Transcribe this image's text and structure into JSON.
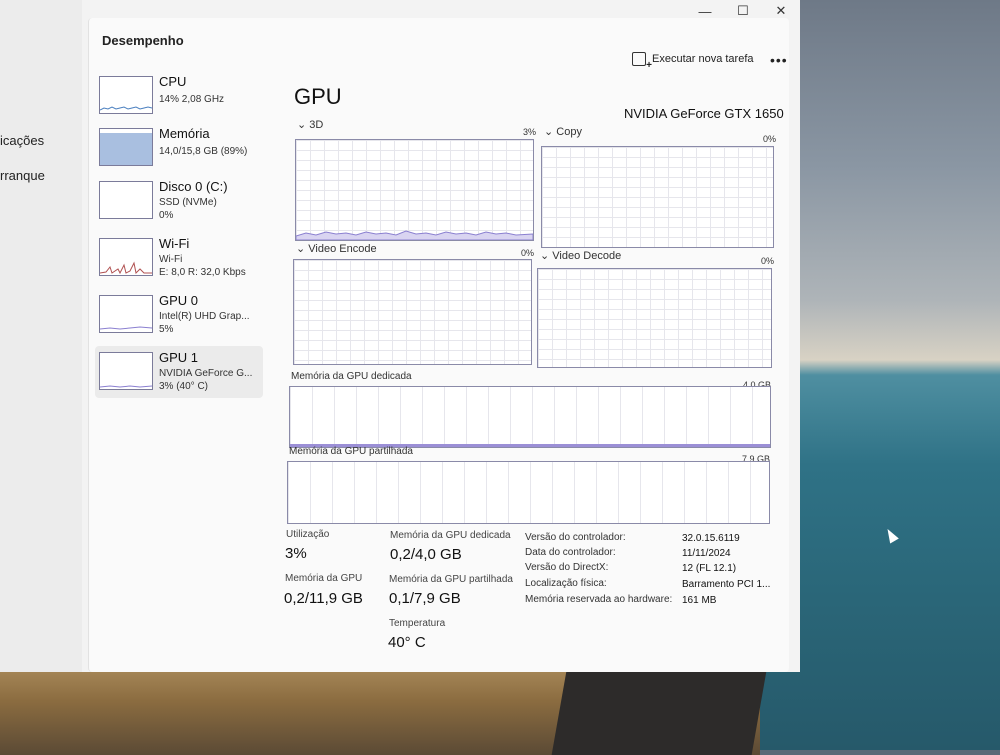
{
  "window": {
    "title": "Desempenho",
    "controls": {
      "minimize": "—",
      "maximize": "☐",
      "close": "✕"
    },
    "new_task_label": "Executar nova tarefa",
    "more_label": "•••"
  },
  "left_strip": {
    "items": [
      "icações",
      "rranque"
    ]
  },
  "sidebar": {
    "items": [
      {
        "name": "CPU",
        "line1": "14% 2,08 GHz",
        "line2": ""
      },
      {
        "name": "Memória",
        "line1": "14,0/15,8 GB (89%)",
        "line2": ""
      },
      {
        "name": "Disco 0 (C:)",
        "line1": "SSD (NVMe)",
        "line2": "0%"
      },
      {
        "name": "Wi-Fi",
        "line1": "Wi-Fi",
        "line2": "E: 8,0 R: 32,0 Kbps"
      },
      {
        "name": "GPU 0",
        "line1": "Intel(R) UHD Grap...",
        "line2": "5%"
      },
      {
        "name": "GPU 1",
        "line1": "NVIDIA GeForce G...",
        "line2": "3% (40° C)"
      }
    ],
    "memory_used_fraction": 0.89
  },
  "gpu": {
    "title": "GPU",
    "model": "NVIDIA GeForce GTX 1650",
    "engines": [
      {
        "label": "3D",
        "percent": "3%"
      },
      {
        "label": "Copy",
        "percent": "0%"
      },
      {
        "label": "Video Encode",
        "percent": "0%"
      },
      {
        "label": "Video Decode",
        "percent": "0%"
      }
    ],
    "dedicated": {
      "label": "Memória da GPU dedicada",
      "max": "4,0 GB",
      "used_fraction": 0.05
    },
    "shared": {
      "label": "Memória da GPU partilhada",
      "max": "7,9 GB",
      "used_fraction": 0.01
    }
  },
  "stats": {
    "utilization": {
      "label": "Utilização",
      "value": "3%"
    },
    "dedicated_memory": {
      "label": "Memória da GPU dedicada",
      "value": "0,2/4,0 GB"
    },
    "gpu_memory": {
      "label": "Memória da GPU",
      "value": "0,2/11,9 GB"
    },
    "shared_memory": {
      "label": "Memória da GPU partilhada",
      "value": "0,1/7,9 GB"
    },
    "temperature": {
      "label": "Temperatura",
      "value": "40° C"
    }
  },
  "details": [
    {
      "key": "Versão do controlador:",
      "value": "32.0.15.6119"
    },
    {
      "key": "Data do controlador:",
      "value": "11/11/2024"
    },
    {
      "key": "Versão do DirectX:",
      "value": "12 (FL 12.1)"
    },
    {
      "key": "Localização física:",
      "value": "Barramento PCI 1..."
    },
    {
      "key": "Memória reservada ao hardware:",
      "value": "161 MB"
    }
  ],
  "colors": {
    "graph_border": "#8a8aa8",
    "gpu_line": "#8a7fd0",
    "memory_fill": "#a9bfe0",
    "wifi_line": "#b05050"
  }
}
